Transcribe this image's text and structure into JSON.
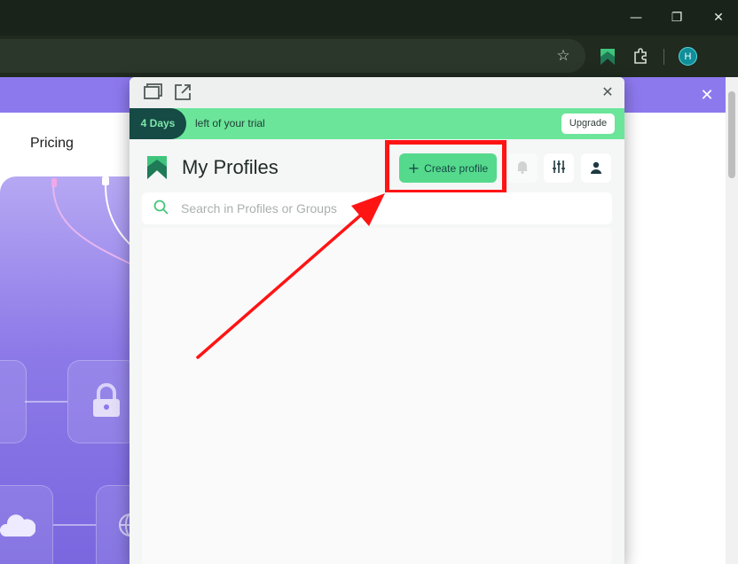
{
  "browser": {
    "window_controls": {
      "minimize": "—",
      "restore": "❐",
      "close": "✕"
    },
    "toolbar_icons": [
      "star-icon",
      "extension-logo-icon",
      "puzzle-icon",
      "profile-avatar"
    ],
    "avatar_letter": "H"
  },
  "page": {
    "nav": {
      "pricing": "Pricing"
    },
    "promo_close": "✕"
  },
  "popup": {
    "header_icons": [
      "window-icon",
      "open-external-icon"
    ],
    "close": "✕",
    "trial": {
      "days": "4 Days",
      "text": "left of your trial",
      "upgrade": "Upgrade"
    },
    "title": "My Profiles",
    "create_button": {
      "icon": "+",
      "label": "Create profile"
    },
    "icon_buttons": [
      "bell-icon",
      "sliders-icon",
      "user-icon"
    ],
    "search": {
      "placeholder": "Search in Profiles or Groups"
    }
  },
  "colors": {
    "accent_green": "#55d98c",
    "trial_bar": "#6be59a",
    "dark_teal": "#154a45",
    "highlight_red": "#ff1414",
    "promo_purple": "#8d79ee"
  }
}
